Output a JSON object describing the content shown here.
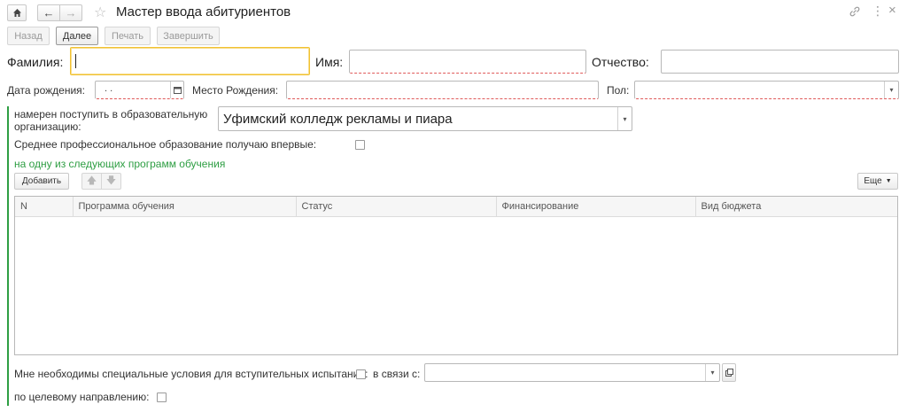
{
  "window": {
    "title": "Мастер ввода абитуриентов"
  },
  "toolbar": {
    "back": "Назад",
    "next": "Далее",
    "print": "Печать",
    "finish": "Завершить"
  },
  "person": {
    "last_name_label": "Фамилия:",
    "last_name_value": "",
    "first_name_label": "Имя:",
    "first_name_value": "",
    "patronymic_label": "Отчество:",
    "patronymic_value": "",
    "birth_date_label": "Дата рождения:",
    "birth_date_value": " .  .",
    "birth_place_label": "Место Рождения:",
    "birth_place_value": "",
    "gender_label": "Пол:",
    "gender_value": ""
  },
  "admission": {
    "org_label": "намерен поступить в образовательную организацию:",
    "org_value": "Уфимский колледж рекламы и пиара",
    "first_time_label": "Среднее профессиональное образование получаю впервые:",
    "programs_heading": "на одну из следующих программ обучения",
    "add_button": "Добавить",
    "more_button": "Еще"
  },
  "table": {
    "columns": [
      "N",
      "Программа обучения",
      "Статус",
      "Финансирование",
      "Вид бюджета"
    ],
    "rows": []
  },
  "bottom": {
    "special_conditions_label": "Мне необходимы специальные условия для вступительных испытаний:",
    "reason_label": "в связи с:",
    "reason_value": "",
    "targeted_label": "по целевому направлению:"
  },
  "colors": {
    "accent_green": "#2e9e43",
    "required_underline": "#e05a5a",
    "focus_border": "#f1c232"
  }
}
